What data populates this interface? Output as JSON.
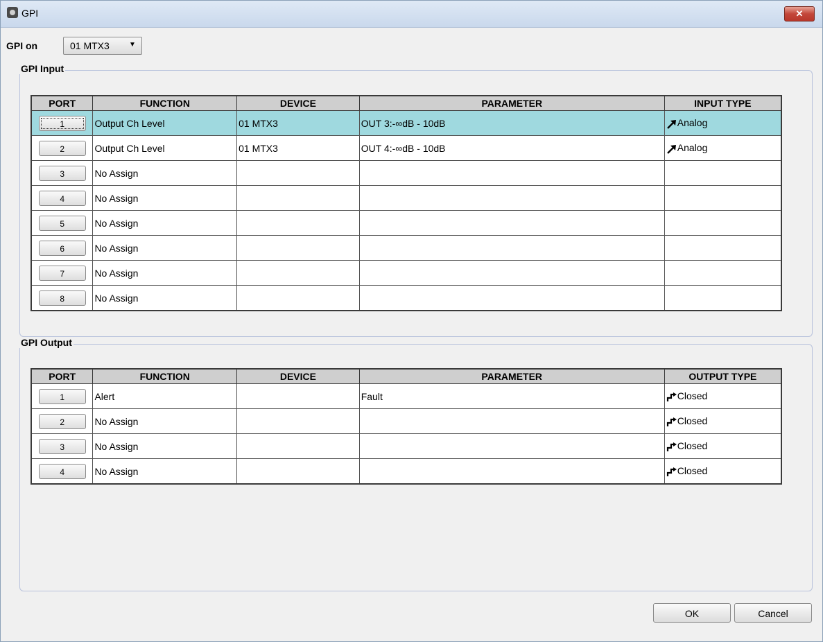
{
  "window": {
    "title": "GPI",
    "close_label": "✕"
  },
  "gpi_on": {
    "label": "GPI on",
    "selected": "01 MTX3"
  },
  "gpi_input": {
    "title": "GPI Input",
    "headers": {
      "port": "PORT",
      "function": "FUNCTION",
      "device": "DEVICE",
      "parameter": "PARAMETER",
      "type": "INPUT TYPE"
    },
    "rows": [
      {
        "port": "1",
        "function": "Output Ch Level",
        "device": "01 MTX3",
        "parameter": "OUT 3:-∞dB - 10dB",
        "type": "Analog"
      },
      {
        "port": "2",
        "function": "Output Ch Level",
        "device": "01 MTX3",
        "parameter": "OUT 4:-∞dB - 10dB",
        "type": "Analog"
      },
      {
        "port": "3",
        "function": "No Assign",
        "device": "",
        "parameter": "",
        "type": ""
      },
      {
        "port": "4",
        "function": "No Assign",
        "device": "",
        "parameter": "",
        "type": ""
      },
      {
        "port": "5",
        "function": "No Assign",
        "device": "",
        "parameter": "",
        "type": ""
      },
      {
        "port": "6",
        "function": "No Assign",
        "device": "",
        "parameter": "",
        "type": ""
      },
      {
        "port": "7",
        "function": "No Assign",
        "device": "",
        "parameter": "",
        "type": ""
      },
      {
        "port": "8",
        "function": "No Assign",
        "device": "",
        "parameter": "",
        "type": ""
      }
    ]
  },
  "gpi_output": {
    "title": "GPI Output",
    "headers": {
      "port": "PORT",
      "function": "FUNCTION",
      "device": "DEVICE",
      "parameter": "PARAMETER",
      "type": "OUTPUT TYPE"
    },
    "rows": [
      {
        "port": "1",
        "function": "Alert",
        "device": "",
        "parameter": "Fault",
        "type": "Closed"
      },
      {
        "port": "2",
        "function": "No Assign",
        "device": "",
        "parameter": "",
        "type": "Closed"
      },
      {
        "port": "3",
        "function": "No Assign",
        "device": "",
        "parameter": "",
        "type": "Closed"
      },
      {
        "port": "4",
        "function": "No Assign",
        "device": "",
        "parameter": "",
        "type": "Closed"
      }
    ]
  },
  "buttons": {
    "ok": "OK",
    "cancel": "Cancel"
  },
  "colors": {
    "selected_row": "#9fd9df",
    "header_bg": "#cfcfcf",
    "close_button": "#c3473a"
  },
  "icons": {
    "analog_type": "diagonal-arrow-icon",
    "closed_type": "step-arrow-icon"
  }
}
